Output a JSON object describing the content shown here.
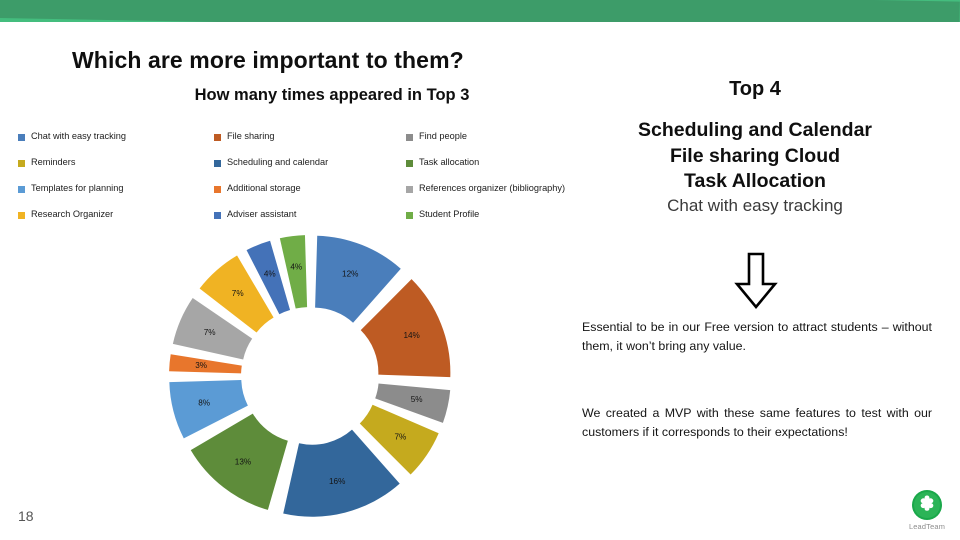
{
  "banner": {
    "light_color": "#44bd7e",
    "dark_color": "#3d9c69"
  },
  "heading": {
    "title": "Which are more important to them?",
    "subtitle": "How many times appeared in Top 3"
  },
  "legend": {
    "items": [
      {
        "label": "Chat with easy tracking",
        "color": "#4a7ebb"
      },
      {
        "label": "File sharing",
        "color": "#be5b23"
      },
      {
        "label": "Find people",
        "color": "#8c8c8c"
      },
      {
        "label": "Reminders",
        "color": "#c5aa1e"
      },
      {
        "label": "Scheduling and calendar",
        "color": "#33679b"
      },
      {
        "label": "Task allocation",
        "color": "#5e8c3a"
      },
      {
        "label": "Templates for planning",
        "color": "#5b9bd5"
      },
      {
        "label": "Additional storage",
        "color": "#e8762c"
      },
      {
        "label": "References organizer (bibliography)",
        "color": "#a6a6a6"
      },
      {
        "label": "Research Organizer",
        "color": "#f0b323"
      },
      {
        "label": "Adviser assistant",
        "color": "#4472b8"
      },
      {
        "label": "Student Profile",
        "color": "#70ad47"
      }
    ]
  },
  "chart_data": {
    "type": "pie",
    "variant": "exploded-doughnut",
    "title": "How many times appeared in Top 3",
    "legend_position": "top",
    "labels": [
      "12%",
      "14%",
      "5%",
      "7%",
      "16%",
      "13%",
      "8%",
      "3%",
      "7%",
      "7%",
      "4%",
      "4%"
    ],
    "categories": [
      "Chat with easy tracking",
      "File sharing",
      "Find people",
      "Reminders",
      "Scheduling and calendar",
      "Task allocation",
      "Templates for planning",
      "Additional storage",
      "References organizer (bibliography)",
      "Research Organizer",
      "Adviser assistant",
      "Student Profile"
    ],
    "values": [
      12,
      14,
      5,
      7,
      16,
      13,
      8,
      3,
      7,
      7,
      4,
      4
    ],
    "colors": [
      "#4a7ebb",
      "#be5b23",
      "#8c8c8c",
      "#c5aa1e",
      "#33679b",
      "#5e8c3a",
      "#5b9bd5",
      "#e8762c",
      "#a6a6a6",
      "#f0b323",
      "#4472b8",
      "#70ad47"
    ],
    "units": "percent"
  },
  "top4": {
    "heading": "Top 4",
    "lines": [
      {
        "text": "Scheduling and Calendar",
        "emphasis": "strong"
      },
      {
        "text": "File sharing Cloud",
        "emphasis": "strong"
      },
      {
        "text": "Task Allocation",
        "emphasis": "strong"
      },
      {
        "text": "Chat with easy tracking",
        "emphasis": "normal"
      }
    ]
  },
  "arrow": {
    "name": "down-arrow",
    "direction": "down"
  },
  "notes": {
    "paragraph_1": "Essential to be in our Free version to attract students – without them, it won’t bring any value.",
    "paragraph_2": "We created a MVP with these same features to test with our customers if it corresponds to their expectations!"
  },
  "footer": {
    "page_number": "18",
    "logo_text": "LeadTeam",
    "logo_color": "#1aa84a"
  }
}
